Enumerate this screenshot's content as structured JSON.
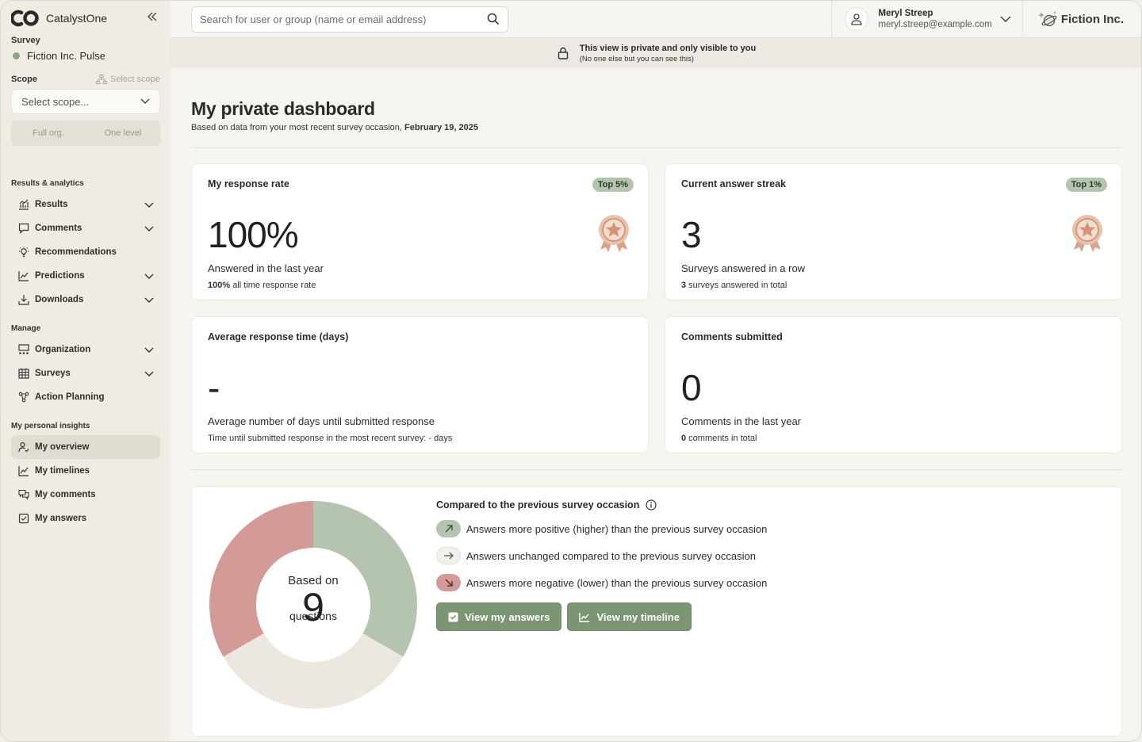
{
  "brand": {
    "name": "CatalystOne"
  },
  "sidebar": {
    "survey_label": "Survey",
    "survey_name": "Fiction Inc. Pulse",
    "scope_label": "Scope",
    "select_scope_link": "Select scope",
    "scope_placeholder": "Select scope...",
    "toggle": {
      "left": "Full org.",
      "right": "One level"
    },
    "sections": {
      "results": "Results & analytics",
      "manage": "Manage",
      "personal": "My personal insights"
    },
    "results_items": [
      {
        "label": "Results"
      },
      {
        "label": "Comments"
      },
      {
        "label": "Recommendations"
      },
      {
        "label": "Predictions"
      },
      {
        "label": "Downloads"
      }
    ],
    "manage_items": [
      {
        "label": "Organization"
      },
      {
        "label": "Surveys"
      },
      {
        "label": "Action Planning"
      }
    ],
    "personal_items": [
      {
        "label": "My overview"
      },
      {
        "label": "My timelines"
      },
      {
        "label": "My comments"
      },
      {
        "label": "My answers"
      }
    ]
  },
  "topbar": {
    "search_placeholder": "Search for user or group (name or email address)",
    "user_name": "Meryl Streep",
    "user_email": "meryl.streep@example.com",
    "company": "Fiction Inc."
  },
  "banner": {
    "title": "This view is private and only visible to you",
    "subtitle": "(No one else but you can see this)"
  },
  "page": {
    "title": "My private dashboard",
    "subtitle_prefix": "Based on data from your most recent survey occasion, ",
    "subtitle_date": "February 19, 2025"
  },
  "cards": {
    "response_rate": {
      "title": "My response rate",
      "badge": "Top 5%",
      "value": "100%",
      "desc": "Answered in the last year",
      "foot_bold": "100%",
      "foot_rest": " all time response rate"
    },
    "streak": {
      "title": "Current answer streak",
      "badge": "Top 1%",
      "value": "3",
      "desc": "Surveys answered in a row",
      "foot_bold": "3",
      "foot_rest": " surveys answered in total"
    },
    "response_time": {
      "title": "Average response time (days)",
      "value": "-",
      "desc": "Average number of days until submitted response",
      "foot": "Time until submitted response in the most recent survey: - days"
    },
    "comments": {
      "title": "Comments submitted",
      "value": "0",
      "desc": "Comments in the last year",
      "foot_bold": "0",
      "foot_rest": " comments in total"
    }
  },
  "comparison": {
    "donut": {
      "based_on": "Based on",
      "count": "9",
      "label": "questions"
    },
    "title": "Compared to the previous survey occasion",
    "items": [
      {
        "label": "Answers more positive (higher) than the previous survey occasion",
        "color": "#b5c4ae"
      },
      {
        "label": "Answers unchanged compared to the previous survey occasion",
        "color": "#ece8df"
      },
      {
        "label": "Answers more negative (lower) than the previous survey occasion",
        "color": "#d49a98"
      }
    ],
    "buttons": {
      "answers": "View my answers",
      "timeline": "View my timeline"
    }
  }
}
